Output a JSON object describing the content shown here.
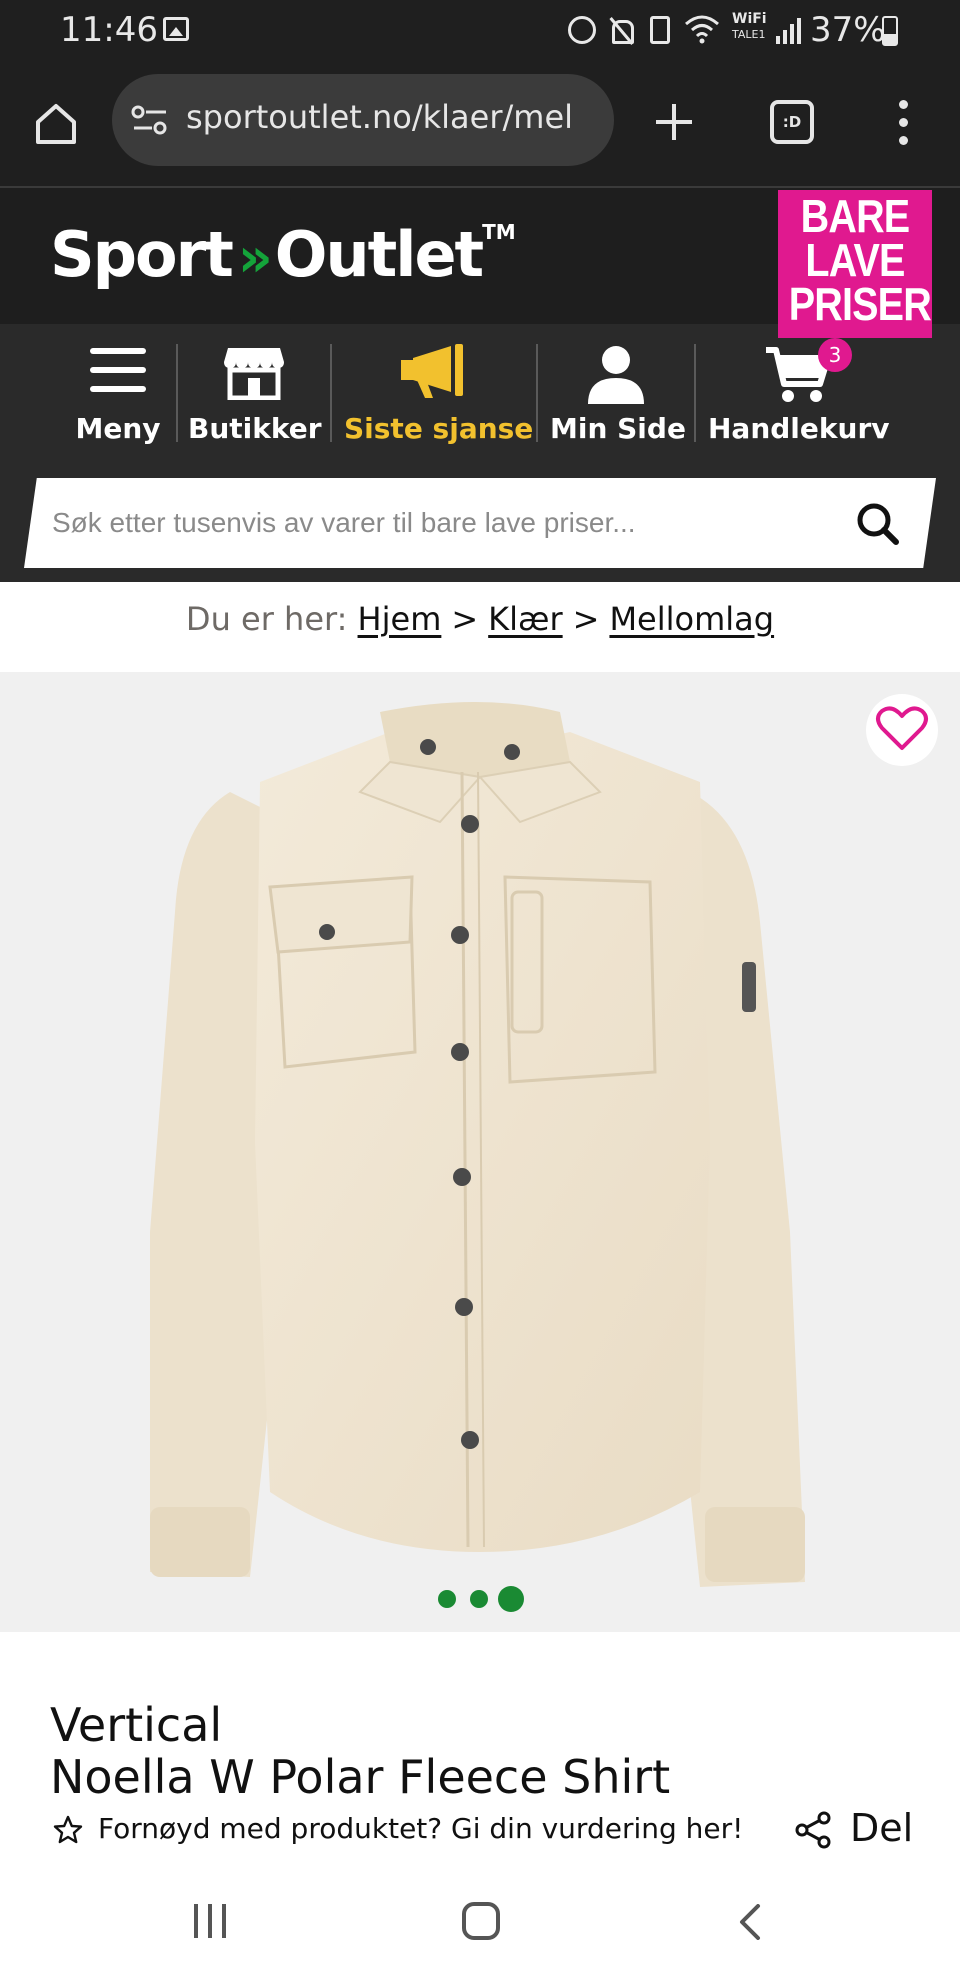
{
  "status_bar": {
    "time": "11:46",
    "wifi_label": "WiFi",
    "wifi_sub": "TALE1",
    "battery": "37%"
  },
  "browser": {
    "url": "sportoutlet.no/klaer/mel",
    "tabs_label": ":D"
  },
  "header": {
    "logo_part1": "Sport",
    "logo_part2": "Outlet",
    "logo_chevrons": "»",
    "logo_tm": "TM",
    "promo_lines": [
      "BARE",
      "LAVE",
      "PRISER"
    ],
    "promo_color": "#e0198f"
  },
  "nav": {
    "items": [
      {
        "label": "Meny",
        "icon": "hamburger-icon"
      },
      {
        "label": "Butikker",
        "icon": "store-icon"
      },
      {
        "label": "Siste sjanse",
        "icon": "megaphone-icon"
      },
      {
        "label": "Min Side",
        "icon": "user-icon"
      },
      {
        "label": "Handlekurv",
        "icon": "cart-icon"
      }
    ],
    "cart_count": "3",
    "highlight_color": "#f2c12e"
  },
  "search": {
    "placeholder": "Søk etter tusenvis av varer til bare lave priser..."
  },
  "breadcrumb": {
    "prefix": "Du er her:",
    "items": [
      "Hjem",
      "Klær",
      "Mellomlag"
    ],
    "separator": ">"
  },
  "carousel": {
    "dot_count": 3,
    "active_index": 2,
    "dot_color": "#1a8a33"
  },
  "product": {
    "brand": "Vertical",
    "name": "Noella W Polar Fleece Shirt",
    "rating_prompt": "Fornøyd med produktet? Gi din vurdering her!",
    "share_label": "Del"
  }
}
